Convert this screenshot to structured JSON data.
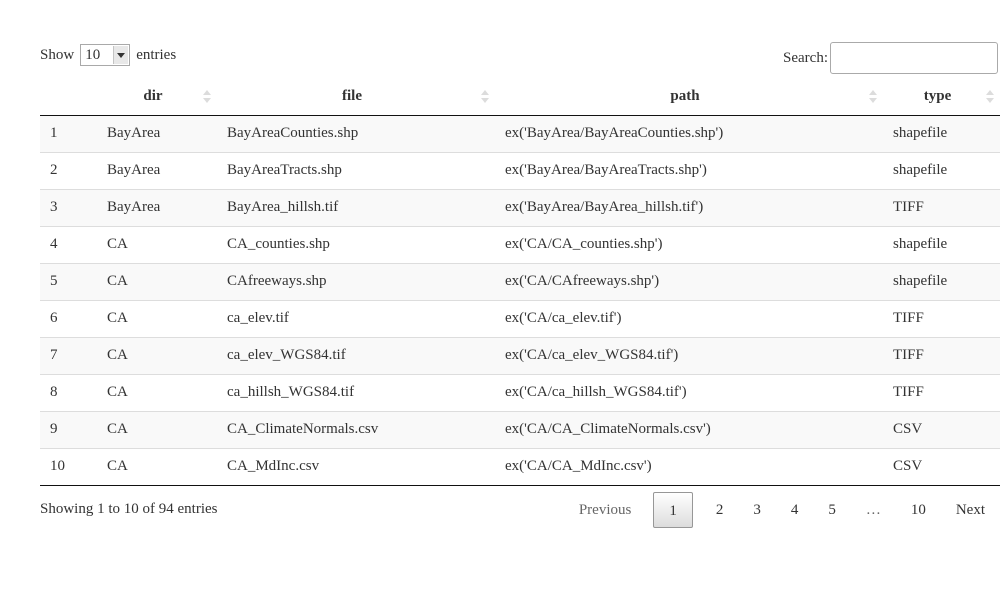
{
  "length_menu": {
    "prefix": "Show",
    "selected": "10",
    "suffix": "entries"
  },
  "search": {
    "label": "Search:",
    "value": ""
  },
  "table": {
    "columns": [
      "",
      "dir",
      "file",
      "path",
      "type"
    ],
    "rows": [
      [
        "1",
        "BayArea",
        "BayAreaCounties.shp",
        "ex('BayArea/BayAreaCounties.shp')",
        "shapefile"
      ],
      [
        "2",
        "BayArea",
        "BayAreaTracts.shp",
        "ex('BayArea/BayAreaTracts.shp')",
        "shapefile"
      ],
      [
        "3",
        "BayArea",
        "BayArea_hillsh.tif",
        "ex('BayArea/BayArea_hillsh.tif')",
        "TIFF"
      ],
      [
        "4",
        "CA",
        "CA_counties.shp",
        "ex('CA/CA_counties.shp')",
        "shapefile"
      ],
      [
        "5",
        "CA",
        "CAfreeways.shp",
        "ex('CA/CAfreeways.shp')",
        "shapefile"
      ],
      [
        "6",
        "CA",
        "ca_elev.tif",
        "ex('CA/ca_elev.tif')",
        "TIFF"
      ],
      [
        "7",
        "CA",
        "ca_elev_WGS84.tif",
        "ex('CA/ca_elev_WGS84.tif')",
        "TIFF"
      ],
      [
        "8",
        "CA",
        "ca_hillsh_WGS84.tif",
        "ex('CA/ca_hillsh_WGS84.tif')",
        "TIFF"
      ],
      [
        "9",
        "CA",
        "CA_ClimateNormals.csv",
        "ex('CA/CA_ClimateNormals.csv')",
        "CSV"
      ],
      [
        "10",
        "CA",
        "CA_MdInc.csv",
        "ex('CA/CA_MdInc.csv')",
        "CSV"
      ]
    ]
  },
  "info": "Showing 1 to 10 of 94 entries",
  "pagination": {
    "previous": "Previous",
    "pages": [
      "1",
      "2",
      "3",
      "4",
      "5"
    ],
    "ellipsis": "…",
    "last": "10",
    "next": "Next",
    "current": "1"
  }
}
